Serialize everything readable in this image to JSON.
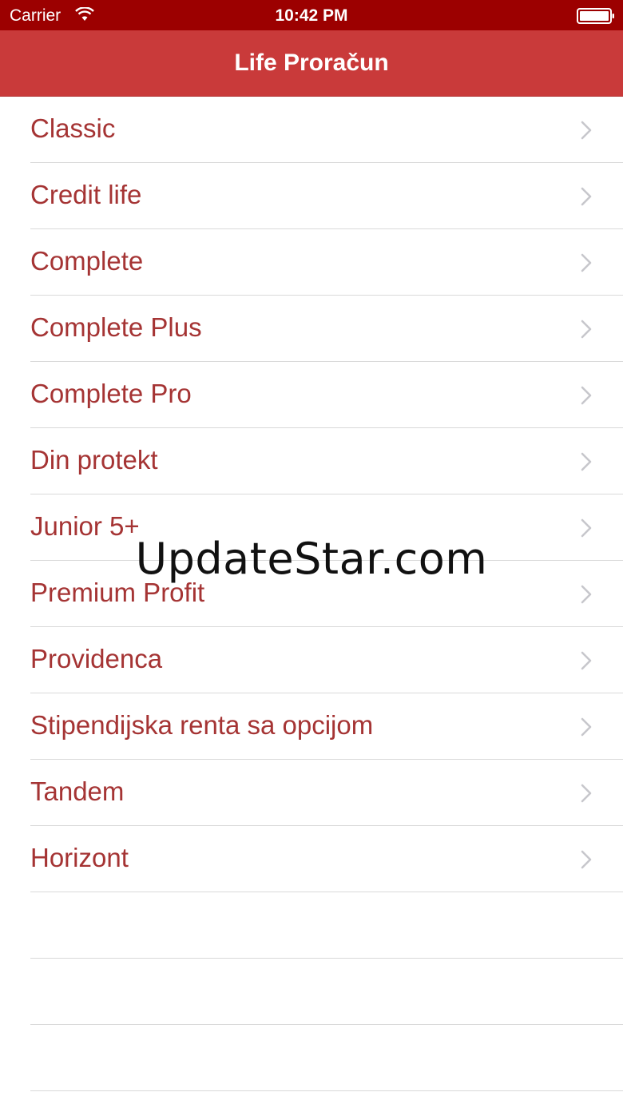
{
  "status_bar": {
    "carrier": "Carrier",
    "time": "10:42 PM",
    "wifi_icon": "wifi-icon",
    "battery_icon": "battery-icon",
    "background": "#9c0000"
  },
  "nav_bar": {
    "title": "Life Proračun",
    "background": "#c93a3a"
  },
  "list": {
    "accent_color": "#a53434",
    "chevron_icon": "chevron-right-icon",
    "items": [
      {
        "label": "Classic"
      },
      {
        "label": "Credit life"
      },
      {
        "label": "Complete"
      },
      {
        "label": "Complete Plus"
      },
      {
        "label": "Complete Pro"
      },
      {
        "label": "Din protekt"
      },
      {
        "label": "Junior 5+"
      },
      {
        "label": "Premium Profit"
      },
      {
        "label": "Providenca"
      },
      {
        "label": "Stipendijska renta sa opcijom"
      },
      {
        "label": "Tandem"
      },
      {
        "label": "Horizont"
      }
    ],
    "empty_rows": 3
  },
  "watermark": "UpdateStar.com"
}
